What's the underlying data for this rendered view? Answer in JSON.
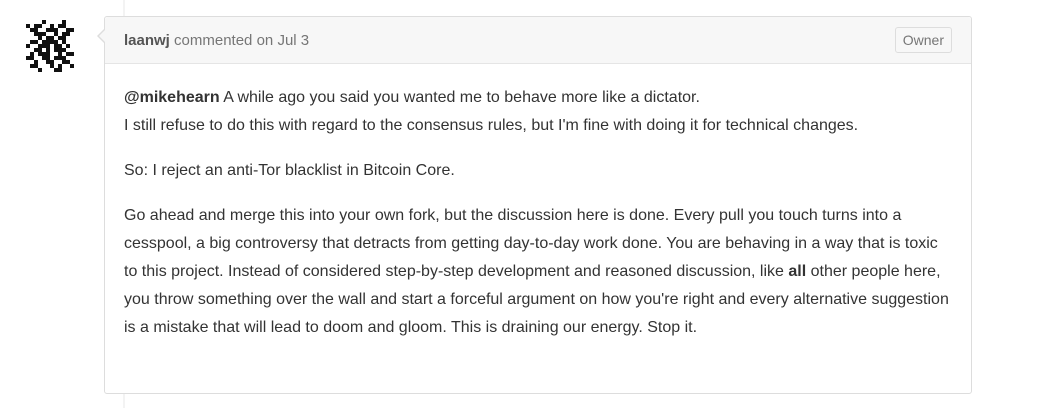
{
  "comment": {
    "author": "laanwj",
    "action": "commented on",
    "date": "Jul 3",
    "badge": "Owner",
    "avatar_icon": "identicon-avatar",
    "p1": {
      "mention": "@mikehearn",
      "line1_text": "A while ago you said you wanted me to behave more like a dictator.",
      "line2": "I still refuse to do this with regard to the consensus rules, but I'm fine with doing it for technical changes."
    },
    "p2": "So: I reject an anti-Tor blacklist in Bitcoin Core.",
    "p3": {
      "text_before_bold": "Go ahead and merge this into your own fork, but the discussion here is done. Every pull you touch turns into a cesspool, a big controversy that detracts from getting day-to-day work done. You are behaving in a way that is toxic to this project. Instead of considered step-by-step development and reasoned discussion, like",
      "bold": "all",
      "text_after_bold": "other people here, you throw something over the wall and start a forceful argument on how you're right and every alternative suggestion is a mistake that will lead to doom and gloom. This is draining our energy. Stop it."
    }
  }
}
